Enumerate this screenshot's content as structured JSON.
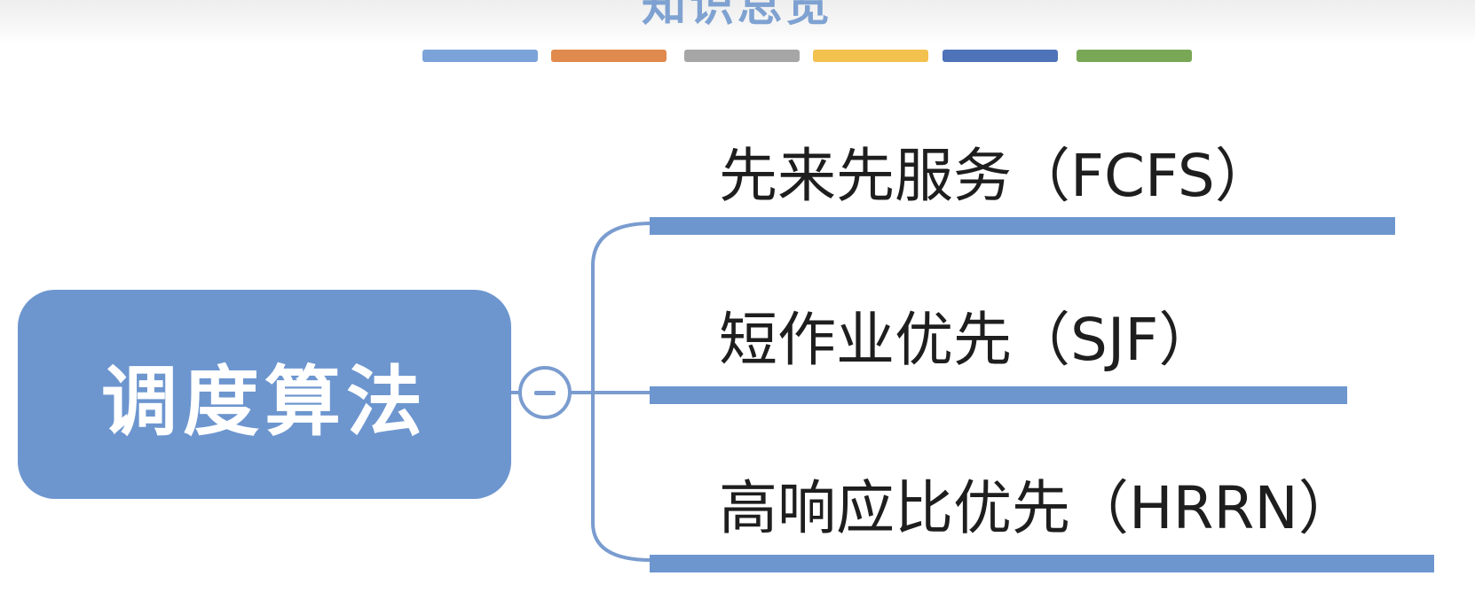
{
  "header": {
    "title": "知识总览",
    "color_swatches": [
      "#7ba3d9",
      "#e08a4e",
      "#a6a6a6",
      "#f3c14e",
      "#4e73b8",
      "#78a856"
    ]
  },
  "mindmap": {
    "root": {
      "label": "调度算法",
      "fill": "#6d96cf"
    },
    "collapse_button": {
      "symbol": "−"
    },
    "branches": [
      {
        "label": "先来先服务（FCFS）"
      },
      {
        "label": "短作业优先（SJF）"
      },
      {
        "label": "高响应比优先（HRRN）"
      }
    ],
    "line_color": "#6d96cf"
  }
}
